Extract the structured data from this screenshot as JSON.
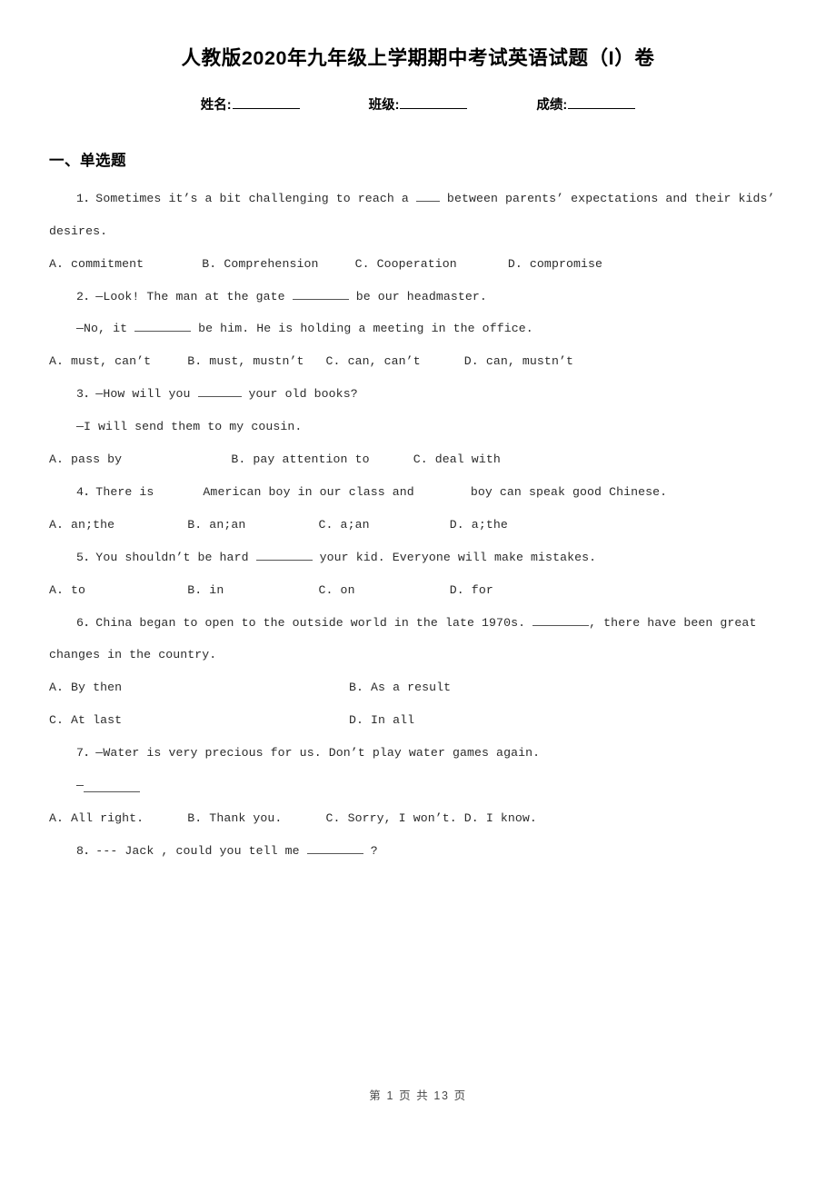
{
  "document": {
    "title": "人教版2020年九年级上学期期中考试英语试题（I）卷",
    "footer": "第 1 页 共 13 页"
  },
  "identity": {
    "name_label": "姓名:",
    "class_label": "班级:",
    "score_label": "成绩:"
  },
  "sections": [
    {
      "heading": "一、单选题"
    }
  ],
  "questions": [
    {
      "number": "1",
      "stem_before": "1．Sometimes it’s a bit challenging to reach a ",
      "stem_after": " between parents’ expectations and their kids’ desires.",
      "options": [
        "A. commitment",
        "B. Comprehension",
        "C. Cooperation",
        "D. compromise"
      ],
      "options_line": "A. commitment        B. Comprehension     C. Cooperation       D. compromise"
    },
    {
      "number": "2",
      "stem_before": "2．—Look! The man at the gate ",
      "stem_after": " be our headmaster.",
      "cont_before": "—No, it ",
      "cont_after": " be him. He is holding a meeting in the office.",
      "options": [
        "A. must, can’t",
        "B. must, mustn’t",
        "C. can, can’t",
        "D. can, mustn’t"
      ],
      "options_line": "A. must, can’t     B. must, mustn’t   C. can, can’t      D. can, mustn’t"
    },
    {
      "number": "3",
      "stem_before": "3．—How will you ",
      "stem_after": " your old books?",
      "cont": "—I will send them to my cousin.",
      "options": [
        "A. pass by",
        "B. pay attention to",
        "C. deal with"
      ],
      "options_line": "A. pass by               B. pay attention to      C. deal with"
    },
    {
      "number": "4",
      "stem_before": "4．There is",
      "stem_mid": "American boy in our class and",
      "stem_after": "boy can speak good Chinese.",
      "options": [
        "A. an;the",
        "B. an;an",
        "C. a;an",
        "D. a;the"
      ],
      "options_line": "A. an;the          B. an;an          C. a;an           D. a;the"
    },
    {
      "number": "5",
      "stem_before": "5．You shouldn’t be hard  ",
      "stem_after": "  your kid. Everyone will make mistakes.",
      "options": [
        "A. to",
        "B. in",
        "C. on",
        "D. for"
      ],
      "options_line": "A. to              B. in             C. on             D. for"
    },
    {
      "number": "6",
      "stem_before": "6．China began to open to the outside world in the late 1970s. ",
      "stem_after": ", there have been great changes in the country.",
      "options": [
        "A. By then",
        "B. As a result",
        "C. At last",
        "D. In all"
      ]
    },
    {
      "number": "7",
      "stem": "7．—Water is very precious for us. Don’t play water games again.",
      "answer_prefix": "—",
      "options": [
        "A. All right.",
        "B. Thank you.",
        "C. Sorry, I won’t.",
        "D. I know."
      ],
      "options_line": "A. All right.      B. Thank you.      C. Sorry, I won’t. D. I know."
    },
    {
      "number": "8",
      "stem_before": "8．--- Jack , could you tell me ",
      "stem_after": " ?"
    }
  ]
}
